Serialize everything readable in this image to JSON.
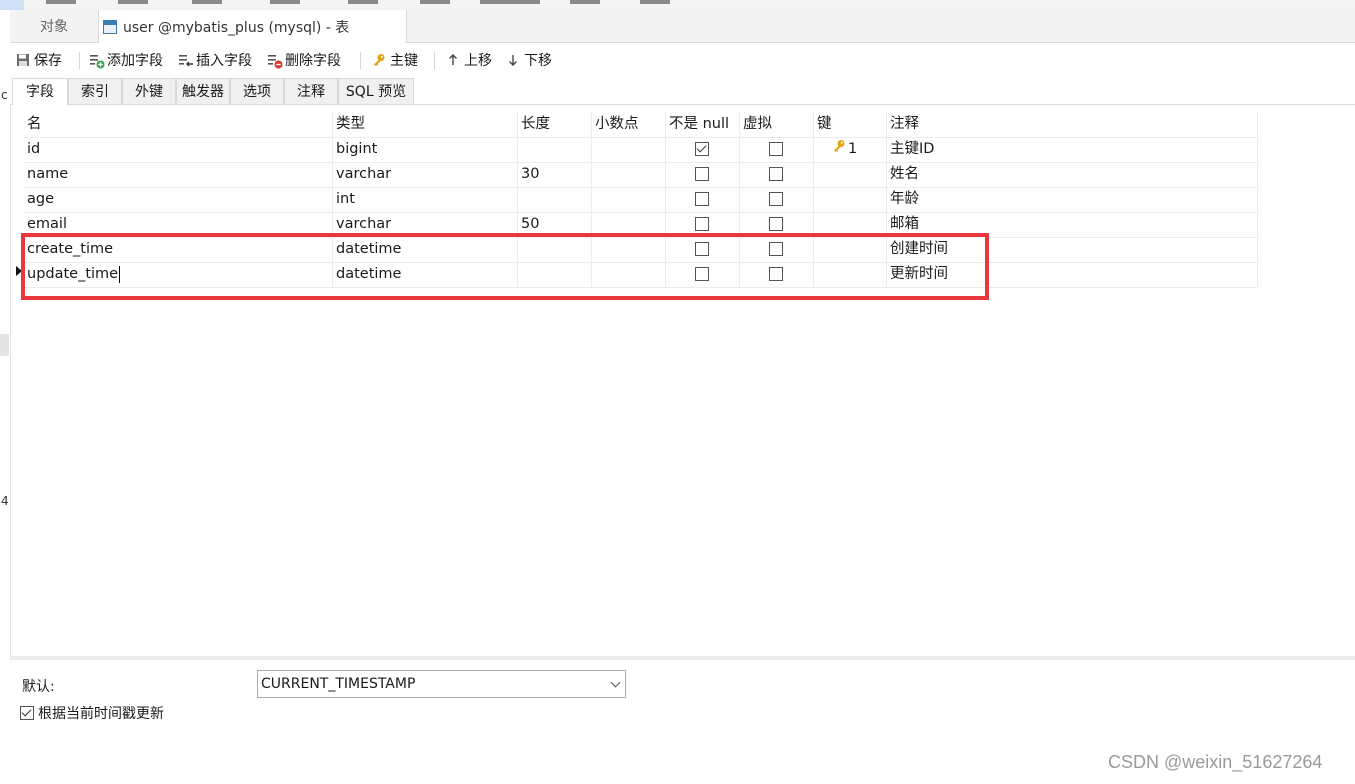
{
  "tabs": {
    "objects": "对象",
    "table_tab": "user @mybatis_plus (mysql) - 表"
  },
  "toolbar": {
    "save": "保存",
    "add_field": "添加字段",
    "insert_field": "插入字段",
    "delete_field": "删除字段",
    "primary_key": "主键",
    "move_up": "上移",
    "move_down": "下移"
  },
  "subtabs": [
    "字段",
    "索引",
    "外键",
    "触发器",
    "选项",
    "注释",
    "SQL 预览"
  ],
  "grid": {
    "headers": [
      "名",
      "类型",
      "长度",
      "小数点",
      "不是 null",
      "虚拟",
      "键",
      "注释"
    ],
    "rows": [
      {
        "name": "id",
        "type": "bigint",
        "length": "",
        "decimals": "",
        "not_null": true,
        "virtual": false,
        "key": "1",
        "comment": "主键ID"
      },
      {
        "name": "name",
        "type": "varchar",
        "length": "30",
        "decimals": "",
        "not_null": false,
        "virtual": false,
        "key": "",
        "comment": "姓名"
      },
      {
        "name": "age",
        "type": "int",
        "length": "",
        "decimals": "",
        "not_null": false,
        "virtual": false,
        "key": "",
        "comment": "年龄"
      },
      {
        "name": "email",
        "type": "varchar",
        "length": "50",
        "decimals": "",
        "not_null": false,
        "virtual": false,
        "key": "",
        "comment": "邮箱"
      },
      {
        "name": "create_time",
        "type": "datetime",
        "length": "",
        "decimals": "",
        "not_null": false,
        "virtual": false,
        "key": "",
        "comment": "创建时间"
      },
      {
        "name": "update_time",
        "type": "datetime",
        "length": "",
        "decimals": "",
        "not_null": false,
        "virtual": false,
        "key": "",
        "comment": "更新时间"
      }
    ]
  },
  "bottom": {
    "default_label": "默认:",
    "default_value": "CURRENT_TIMESTAMP",
    "on_update_label": "根据当前时间戳更新",
    "on_update_checked": true
  },
  "gutter": [
    "c",
    "4"
  ],
  "watermark": "CSDN @weixin_51627264",
  "colors": {
    "highlight": "#e8383d",
    "key_icon": "#e0a514",
    "tab_icon": "#3d7ab8"
  }
}
